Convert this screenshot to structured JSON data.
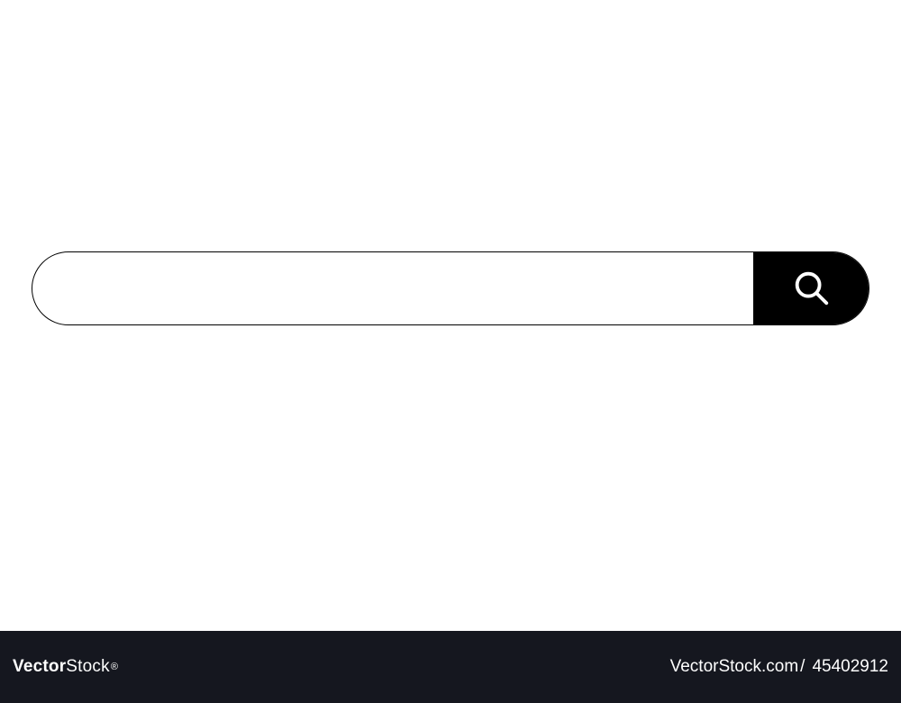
{
  "search": {
    "value": "",
    "placeholder": "",
    "icon": "search-icon"
  },
  "footer": {
    "brand_strong": "Vector",
    "brand_rest": "Stock",
    "reg": "®",
    "site": "VectorStock.com",
    "sep": "/",
    "id": "45402912"
  },
  "colors": {
    "footer_bg": "#15171f",
    "button_bg": "#000000",
    "page_bg": "#ffffff"
  }
}
